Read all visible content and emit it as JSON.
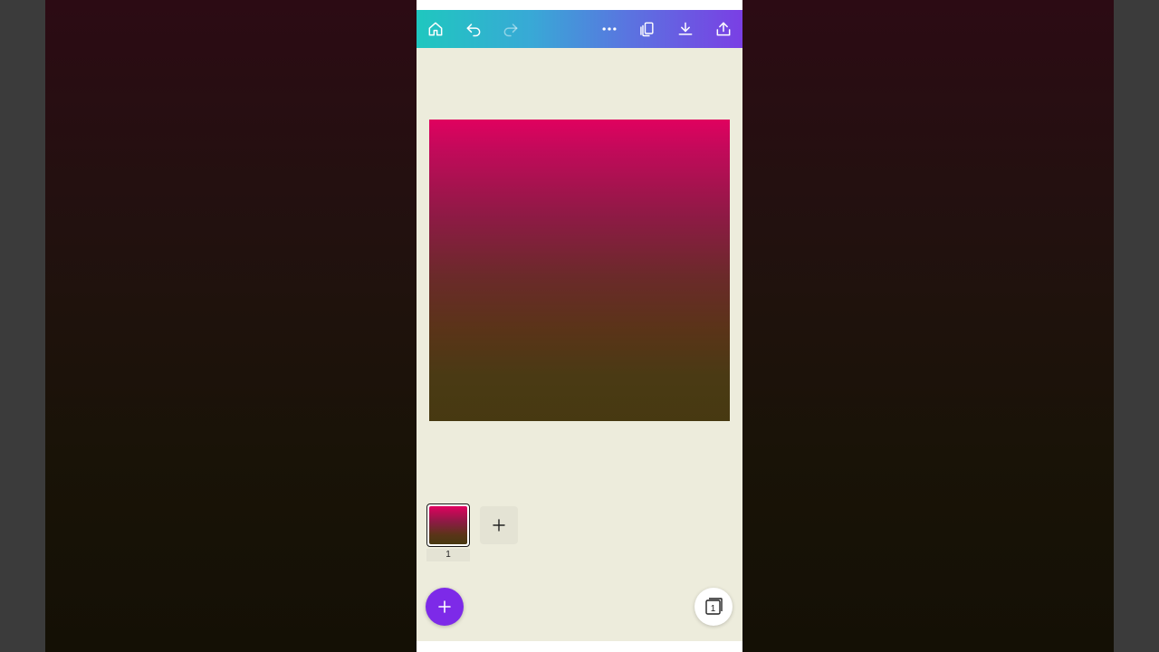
{
  "toolbar": {
    "icons": [
      "home-icon",
      "undo-icon",
      "redo-icon",
      "more-icon",
      "duplicate-icon",
      "download-icon",
      "share-icon"
    ],
    "gradient": [
      "#1fc7bf",
      "#38a9d6",
      "#5a74e0",
      "#7a3fe4"
    ]
  },
  "canvas": {
    "gradient_top": "#e0015f",
    "gradient_bottom": "#473911"
  },
  "pages": {
    "thumbnails": [
      {
        "number": "1"
      }
    ],
    "add_icon": "plus-icon"
  },
  "bottom": {
    "fab_icon": "plus-icon",
    "fab_color": "#7d2ae8",
    "pages_icon": "page-count-icon",
    "pages_count": "1"
  }
}
